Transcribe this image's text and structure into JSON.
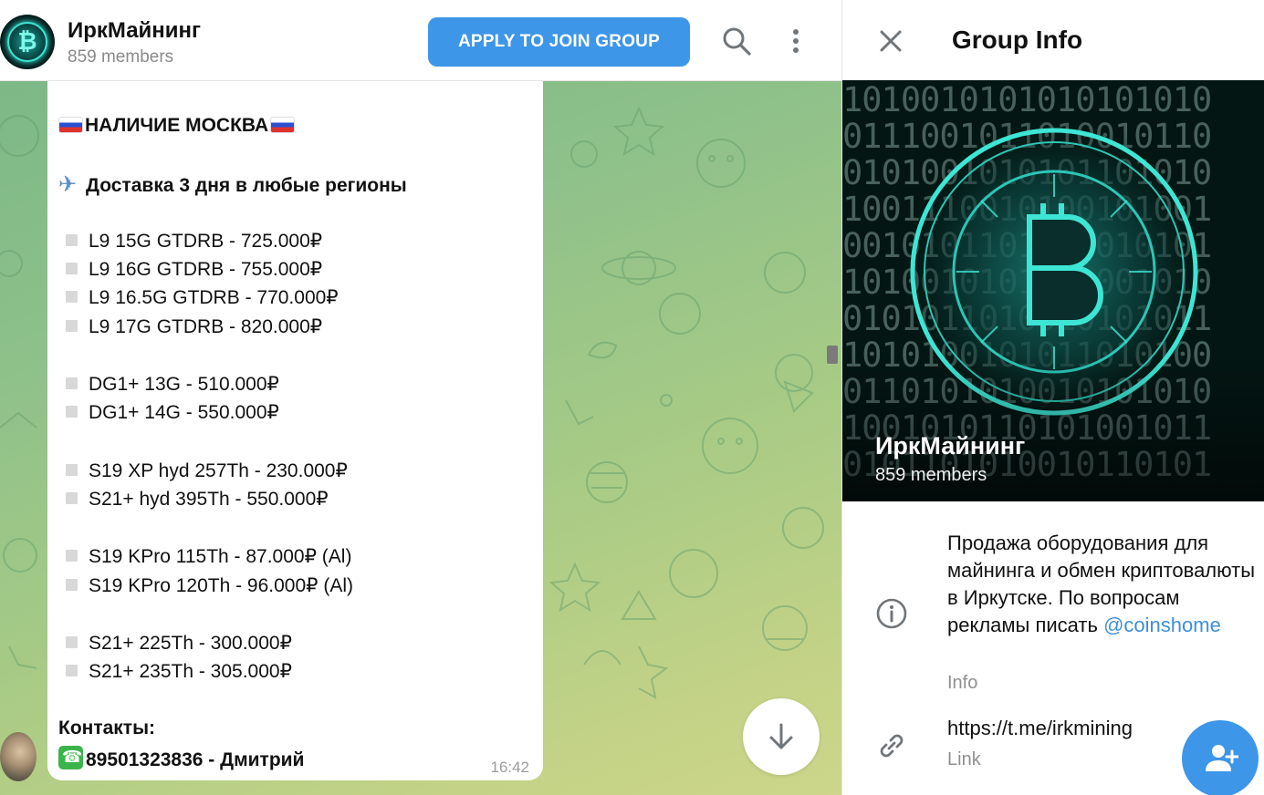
{
  "header": {
    "title": "ИркМайнинг",
    "members": "859 members",
    "join_label": "APPLY TO JOIN GROUP",
    "search_icon": "search-icon",
    "more_icon": "more-vertical-icon"
  },
  "message": {
    "title": "НАЛИЧИЕ МОСКВА",
    "delivery": "Доставка 3 дня в любые регионы",
    "items": [
      "L9 15G GTDRB - 725.000₽",
      "L9 16G GTDRB - 755.000₽",
      "L9 16.5G GTDRB - 770.000₽",
      "L9 17G GTDRB - 820.000₽",
      "DG1+ 13G - 510.000₽",
      "DG1+ 14G - 550.000₽",
      "S19 XP hyd 257Th - 230.000₽",
      "S21+ hyd 395Th - 550.000₽",
      "S19 KPro 115Th - 87.000₽ (Al)",
      "S19 KPro 120Th - 96.000₽ (Al)",
      "S21+ 225Th - 300.000₽",
      "S21+ 235Th - 305.000₽"
    ],
    "contacts_label": "Контакты:",
    "contact": "89501323836 - Дмитрий",
    "time": "16:42"
  },
  "info_panel": {
    "title": "Group Info",
    "group_name": "ИркМайнинг",
    "members": "859 members",
    "description_text": "Продажа оборудования для майнинга и обмен криптовалюты в Иркутске. По вопросам рекламы писать ",
    "description_mention": "@coinshome",
    "description_label": "Info",
    "link": "https://t.me/irkmining",
    "link_label": "Link"
  },
  "colors": {
    "accent": "#3d96e8",
    "chat_bg_top": "#7db887",
    "chat_bg_bottom": "#cdd68a",
    "cover_glow": "#3de6d4"
  }
}
